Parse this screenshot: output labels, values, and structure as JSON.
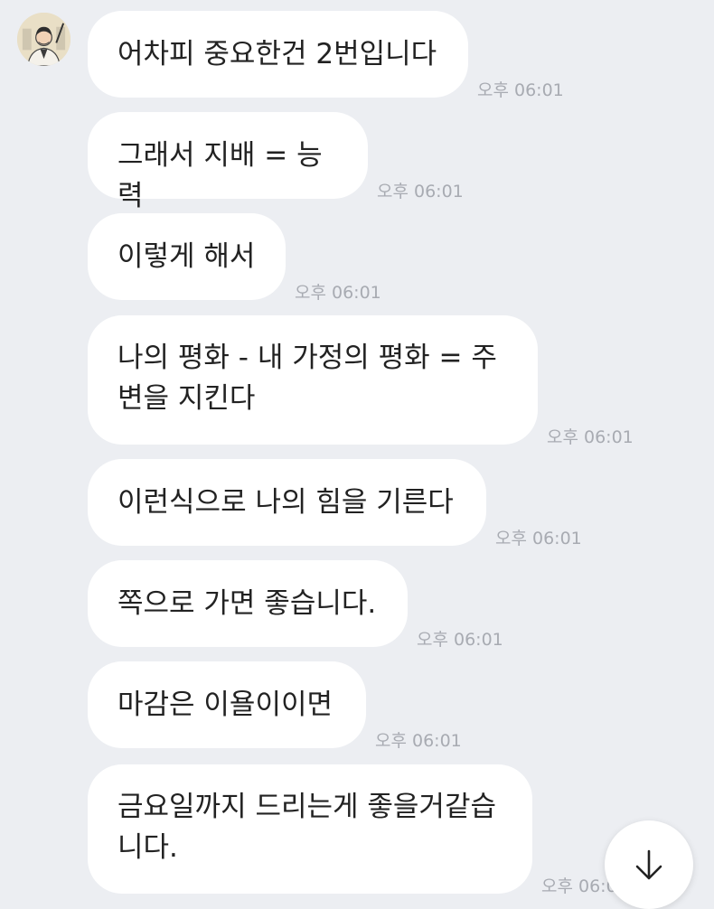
{
  "chat": {
    "avatar_icon": "person-avatar-icon",
    "messages": [
      {
        "text": "어차피 중요한건 2번입니다",
        "time": "오후 06:01"
      },
      {
        "text": "그래서 지배 = 능력",
        "time": "오후 06:01"
      },
      {
        "text": "이렇게 해서",
        "time": "오후 06:01"
      },
      {
        "text": "나의 평화 - 내 가정의 평화 = 주변을 지킨다",
        "time": "오후 06:01"
      },
      {
        "text": "이런식으로 나의 힘을 기른다",
        "time": "오후 06:01"
      },
      {
        "text": "쪽으로 가면 좋습니다.",
        "time": "오후 06:01"
      },
      {
        "text": "마감은 이욜이이면",
        "time": "오후 06:01"
      },
      {
        "text": "금요일까지 드리는게 좋을거같습니다.",
        "time": "오후 06:01"
      }
    ]
  },
  "scroll_button": {
    "icon": "arrow-down-icon"
  },
  "colors": {
    "background": "#eceef2",
    "bubble": "#ffffff",
    "text": "#222222",
    "time": "#a8abb2"
  }
}
